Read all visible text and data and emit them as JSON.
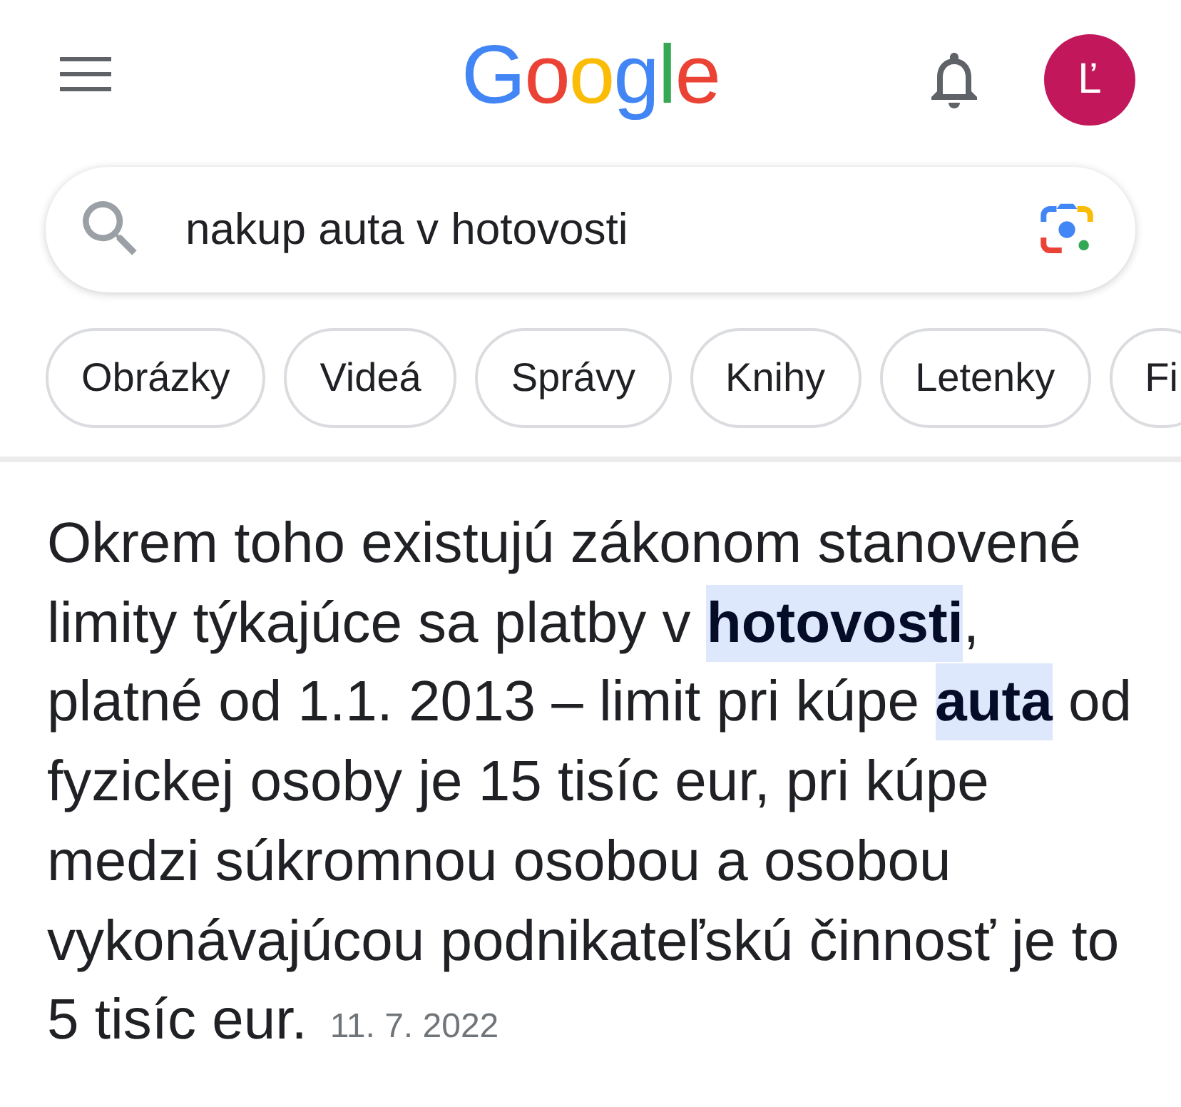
{
  "header": {
    "logo": "Google",
    "avatar": {
      "initial": "Ľ"
    }
  },
  "search": {
    "value": "nakup auta v hotovosti"
  },
  "chips": [
    {
      "label": "Obrázky"
    },
    {
      "label": "Videá"
    },
    {
      "label": "Správy"
    },
    {
      "label": "Knihy"
    },
    {
      "label": "Letenky"
    },
    {
      "label": "Fi"
    }
  ],
  "snippet": {
    "text": "Okrem toho existujú zákonom stanovené limity týkajúce sa platby v **hotovosti**, platné od 1.1. 2013 – limit pri kúpe **auta** od fyzickej osoby je 15 tisíc eur, pri kúpe medzi súkromnou osobou a osobou vykonávajúcou podnikateľskú činnosť je to 5 tisíc eur.",
    "date": "11. 7. 2022"
  }
}
